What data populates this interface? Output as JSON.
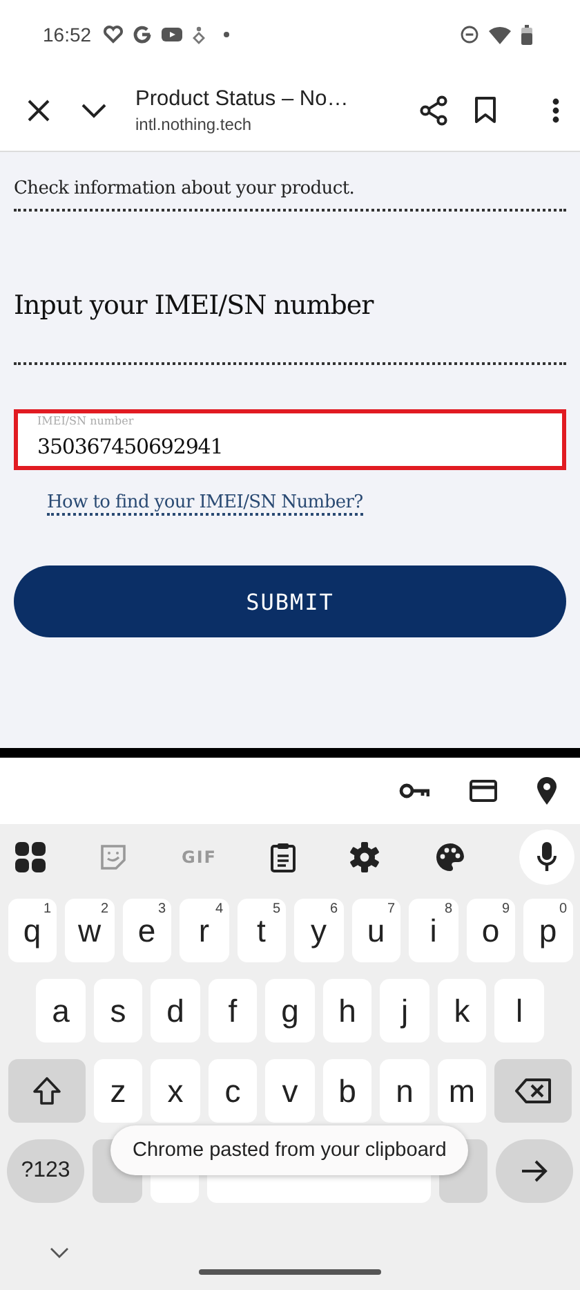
{
  "status_bar": {
    "time": "16:52"
  },
  "toolbar": {
    "title": "Product Status – No…",
    "url": "intl.nothing.tech"
  },
  "page": {
    "intro": "Check information about your product.",
    "heading": "Input your IMEI/SN number",
    "field": {
      "label": "IMEI/SN number",
      "value": "350367450692941",
      "highlighted": true
    },
    "link": "How to find your IMEI/SN Number?",
    "submit": "SUBMIT"
  },
  "keyboard": {
    "gif": "GIF",
    "rows": [
      [
        {
          "kind": "letter",
          "label": "q",
          "hint": "1"
        },
        {
          "kind": "letter",
          "label": "w",
          "hint": "2"
        },
        {
          "kind": "letter",
          "label": "e",
          "hint": "3"
        },
        {
          "kind": "letter",
          "label": "r",
          "hint": "4"
        },
        {
          "kind": "letter",
          "label": "t",
          "hint": "5"
        },
        {
          "kind": "letter",
          "label": "y",
          "hint": "6"
        },
        {
          "kind": "letter",
          "label": "u",
          "hint": "7"
        },
        {
          "kind": "letter",
          "label": "i",
          "hint": "8"
        },
        {
          "kind": "letter",
          "label": "o",
          "hint": "9"
        },
        {
          "kind": "letter",
          "label": "p",
          "hint": "0"
        }
      ],
      [
        {
          "kind": "letter",
          "label": "a"
        },
        {
          "kind": "letter",
          "label": "s"
        },
        {
          "kind": "letter",
          "label": "d"
        },
        {
          "kind": "letter",
          "label": "f"
        },
        {
          "kind": "letter",
          "label": "g"
        },
        {
          "kind": "letter",
          "label": "h"
        },
        {
          "kind": "letter",
          "label": "j"
        },
        {
          "kind": "letter",
          "label": "k"
        },
        {
          "kind": "letter",
          "label": "l"
        }
      ],
      [
        {
          "kind": "shift"
        },
        {
          "kind": "letter",
          "label": "z"
        },
        {
          "kind": "letter",
          "label": "x"
        },
        {
          "kind": "letter",
          "label": "c"
        },
        {
          "kind": "letter",
          "label": "v"
        },
        {
          "kind": "letter",
          "label": "b"
        },
        {
          "kind": "letter",
          "label": "n"
        },
        {
          "kind": "letter",
          "label": "m"
        },
        {
          "kind": "backspace"
        }
      ],
      [
        {
          "kind": "symbols",
          "label": "?123"
        },
        {
          "kind": "punct"
        },
        {
          "kind": "emoji"
        },
        {
          "kind": "space"
        },
        {
          "kind": "punct"
        },
        {
          "kind": "enter"
        }
      ]
    ]
  },
  "toast": "Chrome pasted from your clipboard"
}
